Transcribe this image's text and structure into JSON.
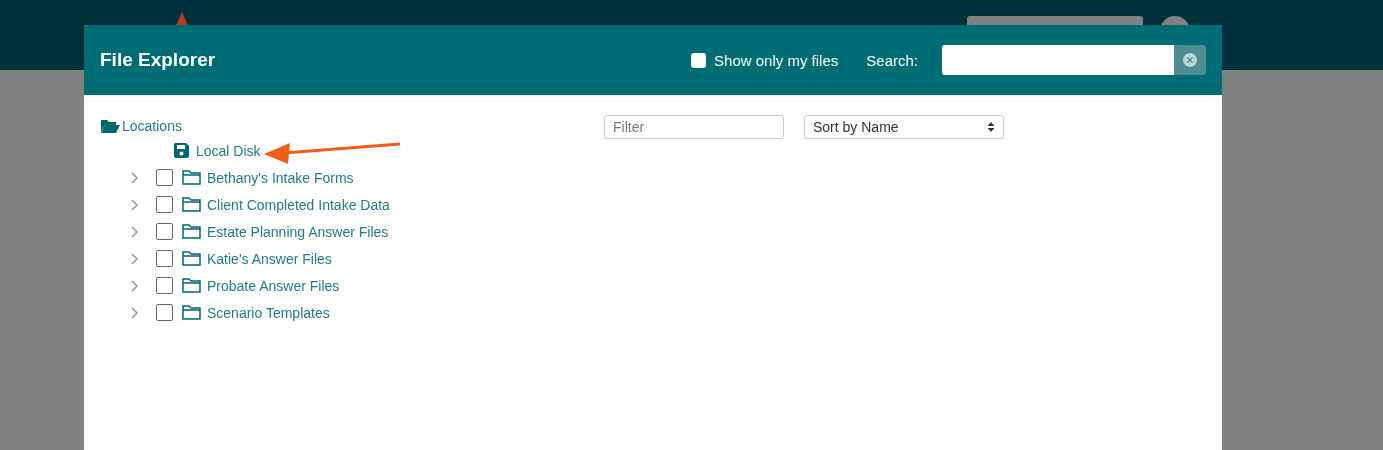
{
  "dialog": {
    "title": "File Explorer",
    "show_only_my_files": {
      "label": "Show only my files",
      "checked": false
    },
    "search": {
      "label": "Search:"
    },
    "tree": {
      "label": "Locations",
      "expanded": true,
      "children": [
        {
          "kind": "disk",
          "label": "Local Disk"
        },
        {
          "kind": "folder",
          "label": "Bethany's Intake Forms",
          "expanded": false,
          "checked": false
        },
        {
          "kind": "folder",
          "label": "Client Completed Intake Data",
          "expanded": false,
          "checked": false
        },
        {
          "kind": "folder",
          "label": "Estate Planning Answer Files",
          "expanded": false,
          "checked": false
        },
        {
          "kind": "folder",
          "label": "Katie's Answer Files",
          "expanded": false,
          "checked": false
        },
        {
          "kind": "folder",
          "label": "Probate Answer Files",
          "expanded": false,
          "checked": false
        },
        {
          "kind": "folder",
          "label": "Scenario Templates",
          "expanded": false,
          "checked": false
        }
      ]
    },
    "filter": {
      "placeholder": "Filter"
    },
    "sort": {
      "value": "Sort by Name"
    }
  }
}
